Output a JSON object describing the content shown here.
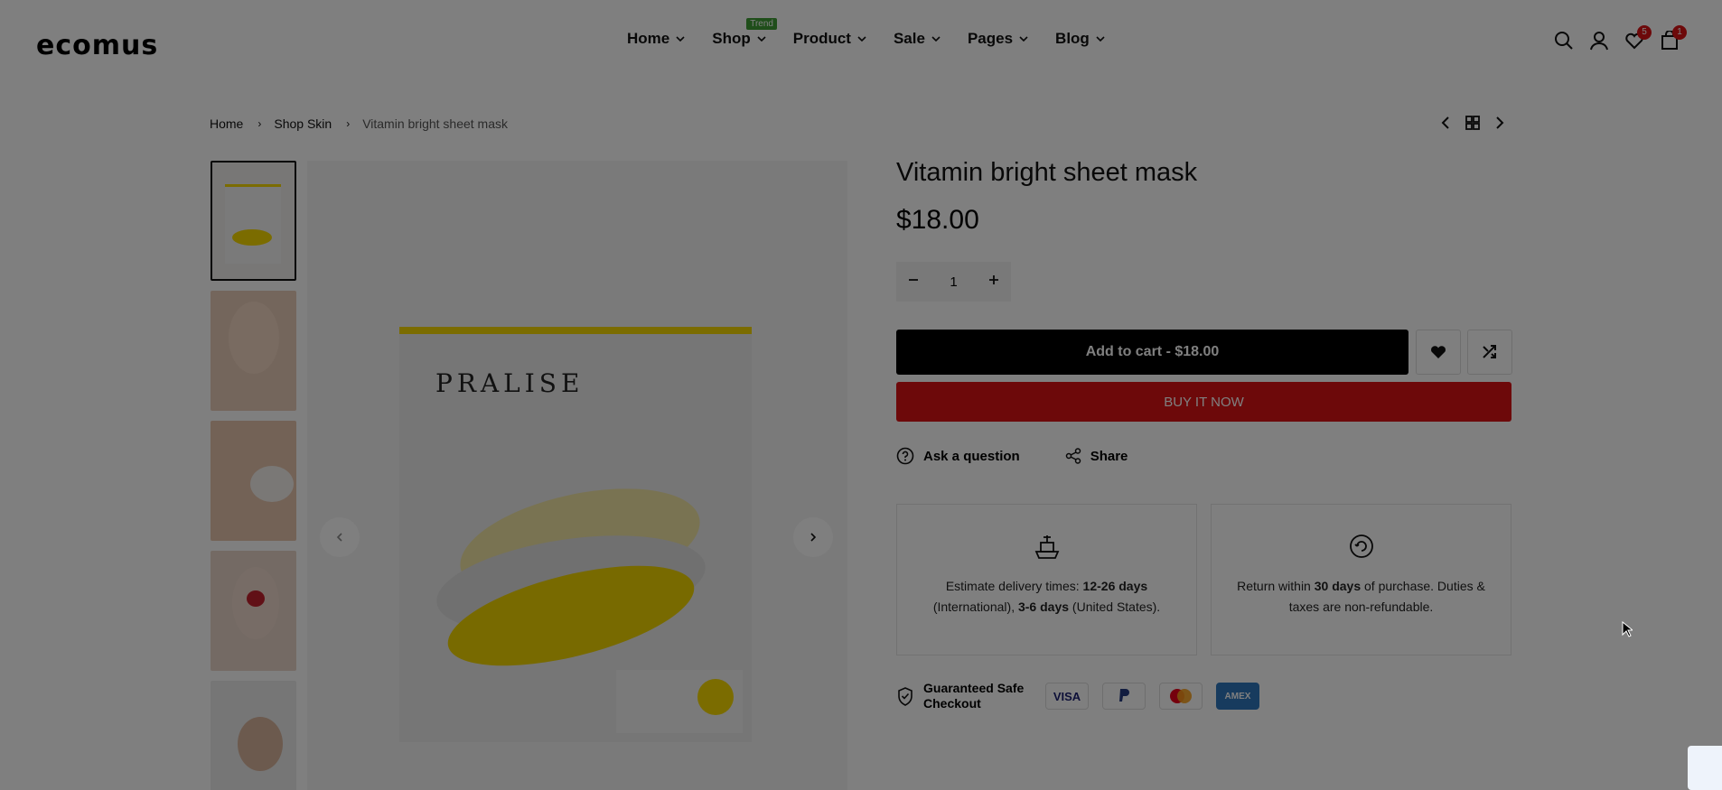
{
  "header": {
    "logo": "ecomus",
    "nav": [
      {
        "label": "Home"
      },
      {
        "label": "Shop",
        "badge": "Trend"
      },
      {
        "label": "Product"
      },
      {
        "label": "Sale"
      },
      {
        "label": "Pages"
      },
      {
        "label": "Blog"
      }
    ],
    "wishlist_count": "5",
    "cart_count": "1",
    "icons": [
      "search-icon",
      "user-icon",
      "heart-icon",
      "cart-icon"
    ]
  },
  "breadcrumb": {
    "items": [
      "Home",
      "Shop Skin"
    ],
    "current": "Vitamin bright sheet mask"
  },
  "gallery": {
    "brand_on_pack": "PRALISE",
    "thumbnail_count": 5
  },
  "product": {
    "title": "Vitamin bright sheet mask",
    "price": "$18.00",
    "quantity": "1",
    "add_to_cart": "Add to cart - $18.00",
    "buy_now": "BUY IT NOW",
    "ask_question": "Ask a question",
    "share": "Share"
  },
  "delivery": {
    "prefix": "Estimate delivery times: ",
    "intl_days": "12-26 days",
    "intl_label": " (International), ",
    "us_days": "3-6 days",
    "us_label": " (United States)."
  },
  "returns": {
    "prefix": "Return within ",
    "days": "30 days",
    "suffix": " of purchase. Duties & taxes are non-refundable."
  },
  "checkout": {
    "label": "Guaranteed Safe Checkout",
    "payment_methods": [
      "VISA",
      "PayPal",
      "Mastercard",
      "AMEX"
    ]
  },
  "colors": {
    "accent_red": "#db1215",
    "trend_green": "#3f9c35",
    "pack_yellow": "#f6d800"
  }
}
